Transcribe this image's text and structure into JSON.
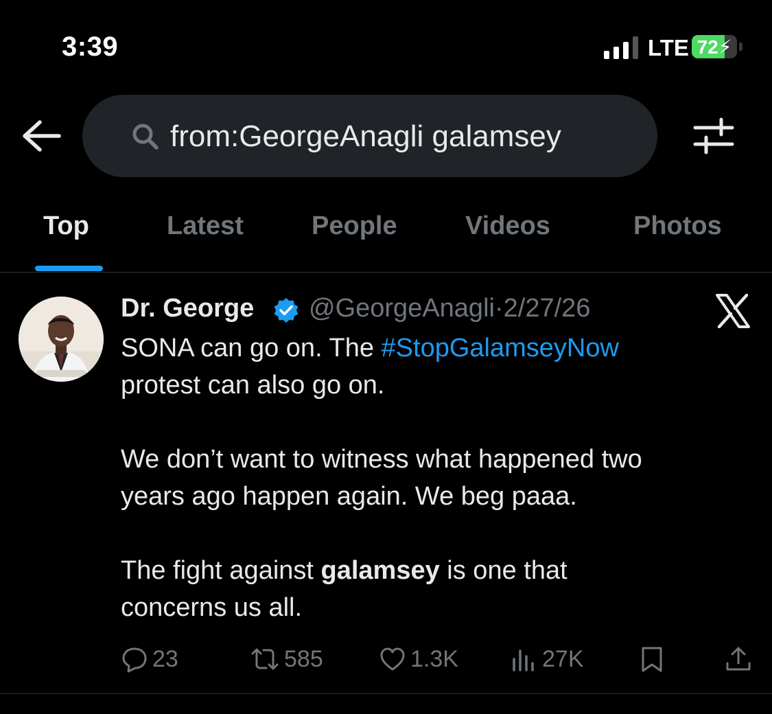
{
  "status_bar": {
    "time": "3:39",
    "network": "LTE",
    "battery_level": "72",
    "battery_fraction": 0.72,
    "charging": true,
    "signal_bars": 3,
    "signal_bars_max": 4
  },
  "search": {
    "query": "from:GeorgeAnagli galamsey",
    "back_icon": "arrow-left-icon",
    "search_icon": "magnifier-icon",
    "filter_icon": "sliders-icon"
  },
  "tabs": [
    {
      "label": "Top",
      "active": true
    },
    {
      "label": "Latest",
      "active": false
    },
    {
      "label": "People",
      "active": false
    },
    {
      "label": "Videos",
      "active": false
    },
    {
      "label": "Photos",
      "active": false
    }
  ],
  "tweet": {
    "author_name": "Dr. George",
    "handle": "@GeorgeAnagli",
    "separator": "·",
    "date": "2/27/26",
    "verified": true,
    "body": {
      "line1_prefix": "SONA can go on. The ",
      "hashtag": "#StopGalamseyNow",
      "line2": "protest can also go on.",
      "line3": "We don’t want to witness what happened two",
      "line4": "years ago happen again. We beg paaa.",
      "line5_prefix": "The fight against ",
      "line5_bold": "galamsey",
      "line5_suffix": " is one that",
      "line6": "concerns us all."
    },
    "actions": {
      "replies": "23",
      "reposts": "585",
      "likes": "1.3K",
      "views": "27K"
    }
  },
  "colors": {
    "background": "#000000",
    "accent": "#1d9bf0",
    "muted": "#71767b",
    "battery": "#4cd964"
  }
}
